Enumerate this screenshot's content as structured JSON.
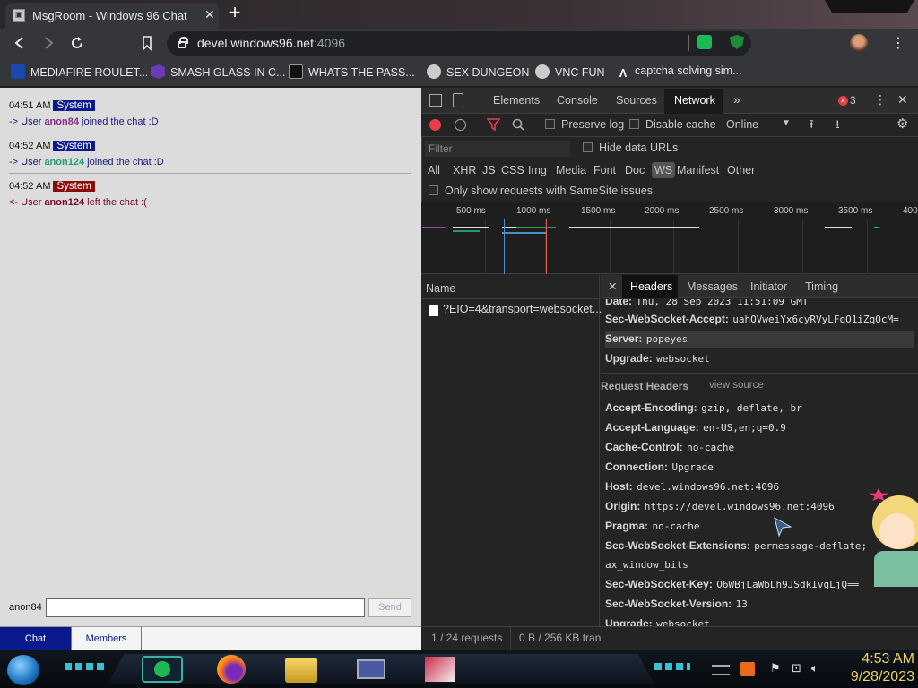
{
  "browser": {
    "tab_title": "MsgRoom - Windows 96 Chat",
    "url_host": "devel.windows96.net",
    "url_port": ":4096",
    "bookmarks": [
      {
        "label": "MEDIAFIRE ROULET...",
        "icon": "mediafire-icon"
      },
      {
        "label": "SMASH GLASS IN C...",
        "icon": "visualstudio-icon"
      },
      {
        "label": "WHATS THE PASS...",
        "icon": "hat-icon"
      },
      {
        "label": "SEX DUNGEON",
        "icon": "gear-icon"
      },
      {
        "label": "VNC FUN",
        "icon": "gear-icon"
      },
      {
        "label": "captcha solving sim...",
        "icon": "a-icon"
      }
    ]
  },
  "chat": {
    "messages": [
      {
        "time": "04:51 AM",
        "badge": "System",
        "badge_color": "#0a1a8c",
        "prefix": "-> User ",
        "user": "anon84",
        "user_color": "#8a2e8a",
        "suffix": " joined the chat :D",
        "text_color": "#1a1a7a"
      },
      {
        "time": "04:52 AM",
        "badge": "System",
        "badge_color": "#0a1a8c",
        "prefix": "-> User ",
        "user": "anon124",
        "user_color": "#2a9a7a",
        "suffix": " joined the chat :D",
        "text_color": "#1a1a7a"
      },
      {
        "time": "04:52 AM",
        "badge": "System",
        "badge_color": "#8c0a0a",
        "prefix": "<- User ",
        "user": "anon124",
        "user_color": "#7a0a2a",
        "suffix": " left the chat :(",
        "text_color": "#7a0a2a"
      }
    ],
    "username": "anon84",
    "input_value": "",
    "send_label": "Send",
    "tabs": [
      "Chat",
      "Members"
    ]
  },
  "devtools": {
    "panels": [
      "Elements",
      "Console",
      "Sources",
      "Network"
    ],
    "error_count": "3",
    "preserve_log": "Preserve log",
    "disable_cache": "Disable cache",
    "throttle": "Online",
    "filter_placeholder": "Filter",
    "hide_data_urls": "Hide data URLs",
    "types": [
      "All",
      "XHR",
      "JS",
      "CSS",
      "Img",
      "Media",
      "Font",
      "Doc",
      "WS",
      "Manifest",
      "Other"
    ],
    "samesite": "Only show requests with SameSite issues",
    "timeline_ticks": [
      "500 ms",
      "1000 ms",
      "1500 ms",
      "2000 ms",
      "2500 ms",
      "3000 ms",
      "3500 ms",
      "400"
    ],
    "name_header": "Name",
    "request_name": "?EIO=4&transport=websocket...",
    "detail_tabs": [
      "Headers",
      "Messages",
      "Initiator",
      "Timing"
    ],
    "response_headers": [
      {
        "key": "Date:",
        "value": "Thu, 28 Sep 2023 11:51:09 GMT"
      },
      {
        "key": "Sec-WebSocket-Accept:",
        "value": "uahQVweiYx6cyRVyLFqO1iZqQcM="
      },
      {
        "key": "Server:",
        "value": "popeyes"
      },
      {
        "key": "Upgrade:",
        "value": "websocket"
      }
    ],
    "request_headers_title": "Request Headers",
    "view_source": "view source",
    "request_headers": [
      {
        "key": "Accept-Encoding:",
        "value": "gzip, deflate, br"
      },
      {
        "key": "Accept-Language:",
        "value": "en-US,en;q=0.9"
      },
      {
        "key": "Cache-Control:",
        "value": "no-cache"
      },
      {
        "key": "Connection:",
        "value": "Upgrade"
      },
      {
        "key": "Host:",
        "value": "devel.windows96.net:4096"
      },
      {
        "key": "Origin:",
        "value": "https://devel.windows96.net:4096"
      },
      {
        "key": "Pragma:",
        "value": "no-cache"
      },
      {
        "key": "Sec-WebSocket-Extensions:",
        "value": "permessage-deflate;"
      },
      {
        "key": "",
        "value": "ax_window_bits"
      },
      {
        "key": "Sec-WebSocket-Key:",
        "value": "O6WBjLaWbLh9JSdkIvgLjQ=="
      },
      {
        "key": "Sec-WebSocket-Version:",
        "value": "13"
      },
      {
        "key": "Upgrade:",
        "value": "websocket"
      }
    ],
    "status_requests": "1 / 24 requests",
    "status_transfer": "0 B / 256 KB tran"
  },
  "taskbar": {
    "time": "4:53 AM",
    "date": "9/28/2023"
  }
}
